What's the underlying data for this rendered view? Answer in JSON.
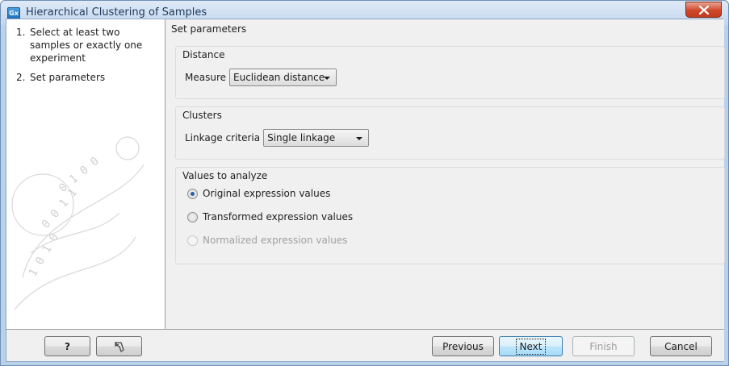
{
  "window": {
    "title": "Hierarchical Clustering of Samples",
    "app_icon_text": "Gx"
  },
  "steps": [
    {
      "num": "1.",
      "label": "Select at least two samples or exactly one experiment"
    },
    {
      "num": "2.",
      "label": "Set parameters"
    }
  ],
  "main": {
    "header": "Set parameters",
    "distance": {
      "title": "Distance",
      "measure_label": "Measure",
      "measure_value": "Euclidean distance"
    },
    "clusters": {
      "title": "Clusters",
      "linkage_label": "Linkage criteria",
      "linkage_value": "Single linkage"
    },
    "values": {
      "title": "Values to analyze",
      "options": [
        {
          "label": "Original expression values",
          "checked": true,
          "enabled": true
        },
        {
          "label": "Transformed expression values",
          "checked": false,
          "enabled": true
        },
        {
          "label": "Normalized expression values",
          "checked": false,
          "enabled": false
        }
      ]
    }
  },
  "footer": {
    "help_label": "?",
    "previous_label": "Previous",
    "next_label": "Next",
    "finish_label": "Finish",
    "cancel_label": "Cancel"
  }
}
